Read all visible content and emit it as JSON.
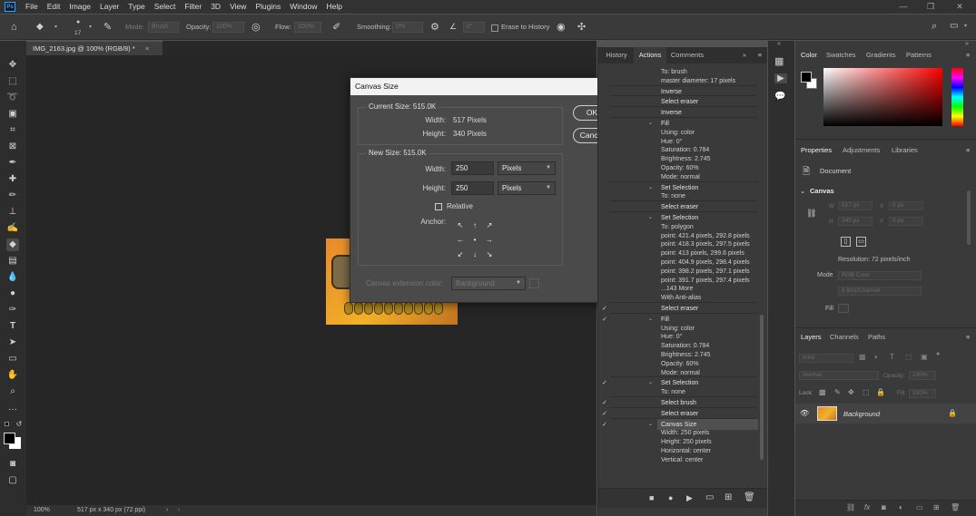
{
  "app": {
    "logo": "Ps",
    "menu": [
      "File",
      "Edit",
      "Image",
      "Layer",
      "Type",
      "Select",
      "Filter",
      "3D",
      "View",
      "Plugins",
      "Window",
      "Help"
    ],
    "window_controls": [
      "minimize-icon",
      "restore-icon",
      "close-icon"
    ]
  },
  "options": {
    "brush_size": "17",
    "mode_label": "Mode:",
    "mode_value": "Brush",
    "opacity_label": "Opacity:",
    "opacity_value": "100%",
    "flow_label": "Flow:",
    "flow_value": "100%",
    "smoothing_label": "Smoothing:",
    "smoothing_value": "0%",
    "angle_value": "0°",
    "erase_history_label": "Erase to History"
  },
  "document": {
    "tab_title": "IMG_2163.jpg @ 100% (RGB/8) *",
    "tab_close": "×",
    "zoom": "100%",
    "dims": "517 px x 340 px (72 ppi)"
  },
  "dialog": {
    "title": "Canvas Size",
    "close": "✕",
    "current_size": "Current Size: 515.0K",
    "width_label": "Width:",
    "current_width": "517 Pixels",
    "height_label": "Height:",
    "current_height": "340 Pixels",
    "new_size": "New Size: 515.0K",
    "new_width": "250",
    "new_height": "250",
    "unit": "Pixels",
    "relative_label": "Relative",
    "anchor_label": "Anchor:",
    "anchor_glyphs": [
      "↖",
      "↑",
      "↗",
      "←",
      "•",
      "→",
      "↙",
      "↓",
      "↘"
    ],
    "extension_label": "Canvas extension color:",
    "extension_value": "Background",
    "ok": "OK",
    "cancel": "Cancel"
  },
  "history_panel": {
    "tabs": [
      "History",
      "Actions",
      "Comments"
    ],
    "actions": [
      {
        "text": "To: brush",
        "head": false
      },
      {
        "text": "master diameter: 17 pixels",
        "head": false
      },
      {
        "text": "Inverse",
        "head": true
      },
      {
        "text": "Select eraser",
        "head": true
      },
      {
        "text": "Inverse",
        "head": true
      },
      {
        "text": "Fill",
        "head": true
      },
      {
        "text": "Using: color",
        "head": false
      },
      {
        "text": "Hue: 0°",
        "head": false
      },
      {
        "text": "Saturation: 0.784",
        "head": false
      },
      {
        "text": "Brightness: 2.745",
        "head": false
      },
      {
        "text": "Opacity: 60%",
        "head": false
      },
      {
        "text": "Mode: normal",
        "head": false
      },
      {
        "text": "Set Selection",
        "head": true
      },
      {
        "text": "To: none",
        "head": false
      },
      {
        "text": "Select eraser",
        "head": true
      },
      {
        "text": "Set Selection",
        "head": true
      },
      {
        "text": "To: polygon",
        "head": false
      },
      {
        "text": "point: 421.4 pixels, 292.8 pixels",
        "head": false
      },
      {
        "text": "point: 418.3 pixels, 297.5 pixels",
        "head": false
      },
      {
        "text": "point: 413 pixels, 299.6 pixels",
        "head": false
      },
      {
        "text": "point: 404.9 pixels, 298.4 pixels",
        "head": false
      },
      {
        "text": "point: 398.2 pixels, 297.1 pixels",
        "head": false
      },
      {
        "text": "point: 391.7 pixels, 297.4 pixels",
        "head": false
      },
      {
        "text": "...143 More",
        "head": false
      },
      {
        "text": "With Anti-alias",
        "head": false
      },
      {
        "text": "Select eraser",
        "head": true
      },
      {
        "text": "Fill",
        "head": true
      },
      {
        "text": "Using: color",
        "head": false
      },
      {
        "text": "Hue: 0°",
        "head": false
      },
      {
        "text": "Saturation: 0.784",
        "head": false
      },
      {
        "text": "Brightness: 2.745",
        "head": false
      },
      {
        "text": "Opacity: 60%",
        "head": false
      },
      {
        "text": "Mode: normal",
        "head": false
      },
      {
        "text": "Set Selection",
        "head": true
      },
      {
        "text": "To: none",
        "head": false
      },
      {
        "text": "Select brush",
        "head": true
      },
      {
        "text": "Select eraser",
        "head": true
      },
      {
        "text": "Canvas Size",
        "head": true
      },
      {
        "text": "Width: 250 pixels",
        "head": false
      },
      {
        "text": "Height: 250 pixels",
        "head": false
      },
      {
        "text": "Horizontal: center",
        "head": false
      },
      {
        "text": "Vertical: center",
        "head": false
      }
    ],
    "check": "✓"
  },
  "color_panel": {
    "tabs": [
      "Color",
      "Swatches",
      "Gradients",
      "Patterns"
    ]
  },
  "properties_panel": {
    "tabs": [
      "Properties",
      "Adjustments",
      "Libraries"
    ],
    "document_label": "Document",
    "section": "Canvas",
    "w_label": "W",
    "w_value": "517 px",
    "h_label": "H",
    "h_value": "340 px",
    "x_label": "X",
    "x_value": "0 px",
    "y_label": "Y",
    "y_value": "0 px",
    "resolution": "Resolution: 72 pixels/inch",
    "mode_label": "Mode",
    "mode_value": "RGB Color",
    "bits_value": "8 Bits/Channel",
    "fill_label": "Fill"
  },
  "layers_panel": {
    "tabs": [
      "Layers",
      "Channels",
      "Paths"
    ],
    "kind_value": "Kind",
    "blend_value": "Normal",
    "opacity_label": "Opacity:",
    "opacity_value": "100%",
    "lock_label": "Lock:",
    "fill_label": "Fill:",
    "fill_value": "100%",
    "layer_name": "Background"
  },
  "colors": {
    "accent": "#31a8ff",
    "panel": "#3a3a3a",
    "canvas": "#262626"
  }
}
